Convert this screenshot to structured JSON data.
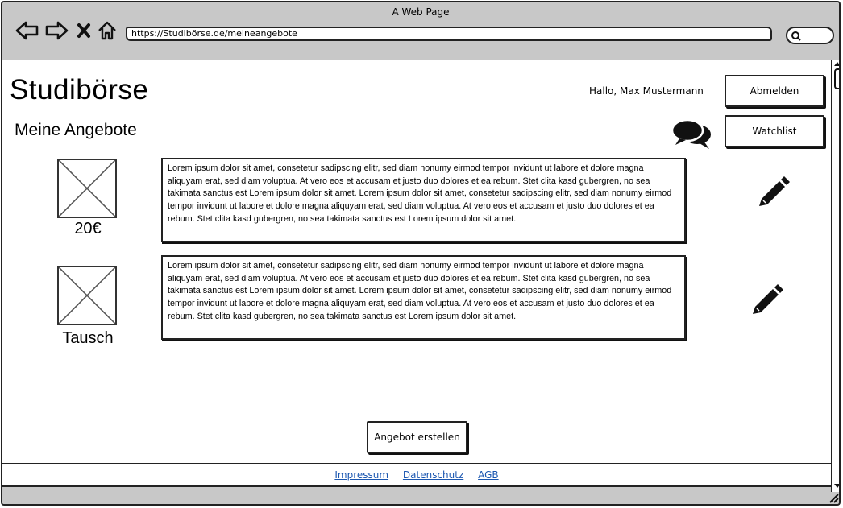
{
  "window": {
    "title": "A Web Page"
  },
  "browser": {
    "url": "https://Studibörse.de/meineangebote"
  },
  "header": {
    "logo": "Studibörse",
    "greeting": "Hallo, Max Mustermann",
    "logout_label": "Abmelden",
    "watchlist_label": "Watchlist"
  },
  "page": {
    "title": "Meine Angebote"
  },
  "offers": [
    {
      "price": "20€",
      "description": "Lorem ipsum dolor sit amet, consetetur sadipscing elitr, sed diam nonumy eirmod tempor invidunt ut labore et dolore magna aliquyam erat, sed diam voluptua. At vero eos et accusam et justo duo dolores et ea rebum. Stet clita kasd gubergren, no sea takimata sanctus est Lorem ipsum dolor sit amet. Lorem ipsum dolor sit amet, consetetur sadipscing elitr, sed diam nonumy eirmod tempor invidunt ut labore et dolore magna aliquyam erat, sed diam voluptua. At vero eos et accusam et justo duo dolores et ea rebum. Stet clita kasd gubergren, no sea takimata sanctus est Lorem ipsum dolor sit amet."
    },
    {
      "price": "Tausch",
      "description": "Lorem ipsum dolor sit amet, consetetur sadipscing elitr, sed diam nonumy eirmod tempor invidunt ut labore et dolore magna aliquyam erat, sed diam voluptua. At vero eos et accusam et justo duo dolores et ea rebum. Stet clita kasd gubergren, no sea takimata sanctus est Lorem ipsum dolor sit amet. Lorem ipsum dolor sit amet, consetetur sadipscing elitr, sed diam nonumy eirmod tempor invidunt ut labore et dolore magna aliquyam erat, sed diam voluptua. At vero eos et accusam et justo duo dolores et ea rebum. Stet clita kasd gubergren, no sea takimata sanctus est Lorem ipsum dolor sit amet."
    }
  ],
  "create_label": "Angebot erstellen",
  "footer": {
    "links": [
      "Impressum",
      "Datenschutz",
      "AGB"
    ]
  },
  "icons": [
    "back-icon",
    "forward-icon",
    "close-icon",
    "home-icon",
    "search-icon",
    "chat-icon",
    "pencil-icon",
    "image-placeholder-icon",
    "resize-grip-icon"
  ],
  "colors": {
    "chrome": "#c8c8c8",
    "link": "#1a56b0"
  }
}
